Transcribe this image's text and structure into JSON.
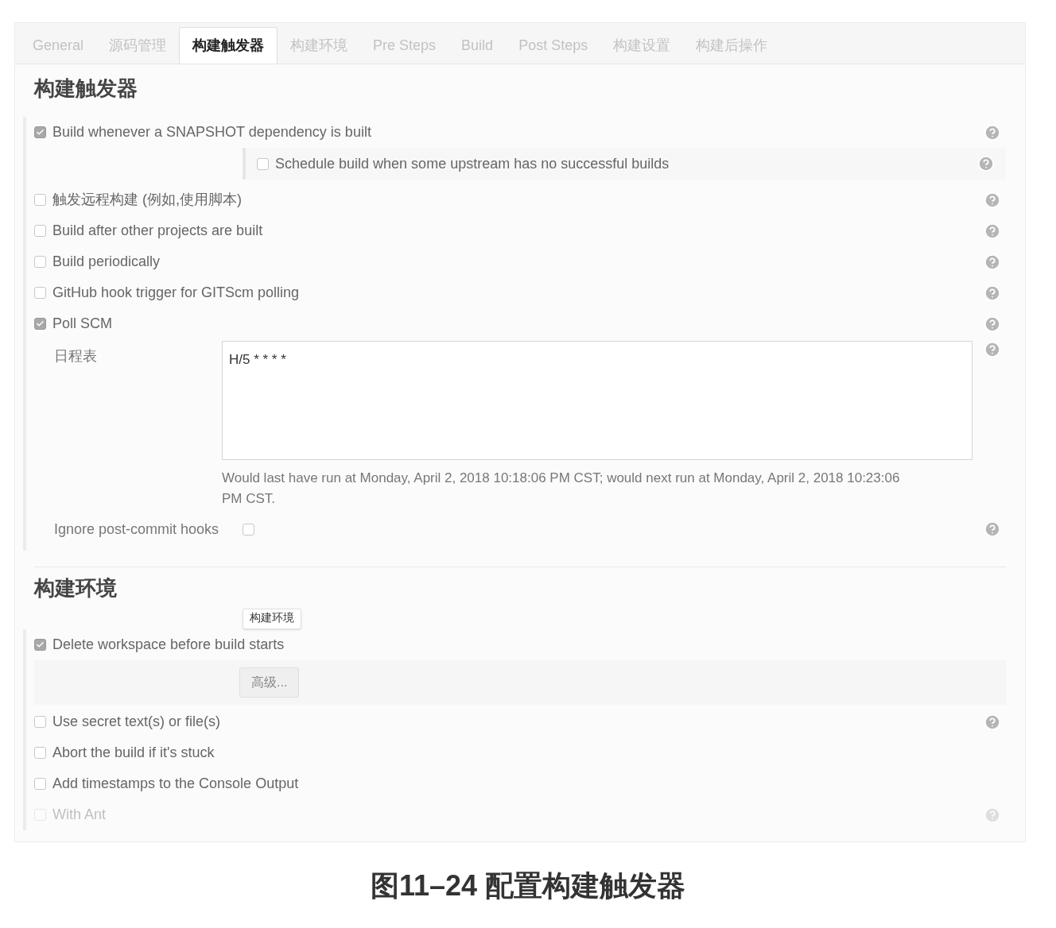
{
  "tabs": [
    {
      "label": "General",
      "selected": false
    },
    {
      "label": "源码管理",
      "selected": false
    },
    {
      "label": "构建触发器",
      "selected": true
    },
    {
      "label": "构建环境",
      "selected": false
    },
    {
      "label": "Pre Steps",
      "selected": false
    },
    {
      "label": "Build",
      "selected": false
    },
    {
      "label": "Post Steps",
      "selected": false
    },
    {
      "label": "构建设置",
      "selected": false
    },
    {
      "label": "构建后操作",
      "selected": false
    }
  ],
  "trigger_section": {
    "title": "构建触发器",
    "options": [
      {
        "label": "Build whenever a SNAPSHOT dependency is built",
        "checked": true,
        "help": true,
        "sub_options": [
          {
            "label": "Schedule build when some upstream has no successful builds",
            "checked": false,
            "help": true
          }
        ]
      },
      {
        "label": "触发远程构建 (例如,使用脚本)",
        "checked": false,
        "help": true
      },
      {
        "label": "Build after other projects are built",
        "checked": false,
        "help": true
      },
      {
        "label": "Build periodically",
        "checked": false,
        "help": true
      },
      {
        "label": "GitHub hook trigger for GITScm polling",
        "checked": false,
        "help": true
      },
      {
        "label": "Poll SCM",
        "checked": true,
        "help": true
      }
    ],
    "poll_scm": {
      "schedule_label": "日程表",
      "schedule_value": "H/5 * * * *",
      "schedule_note": "Would last have run at Monday, April 2, 2018 10:18:06 PM CST; would next run at Monday, April 2, 2018 10:23:06 PM CST.",
      "ignore_hooks_label": "Ignore post-commit hooks",
      "ignore_hooks_checked": false
    }
  },
  "env_section": {
    "title": "构建环境",
    "tooltip": "构建环境",
    "options": [
      {
        "label": "Delete workspace before build starts",
        "checked": true,
        "help": false,
        "advanced_button": "高级..."
      },
      {
        "label": "Use secret text(s) or file(s)",
        "checked": false,
        "help": true
      },
      {
        "label": "Abort the build if it's stuck",
        "checked": false,
        "help": false
      },
      {
        "label": "Add timestamps to the Console Output",
        "checked": false,
        "help": false
      },
      {
        "label": "With Ant",
        "checked": false,
        "help": true
      }
    ]
  },
  "caption": "图11–24 配置构建触发器"
}
